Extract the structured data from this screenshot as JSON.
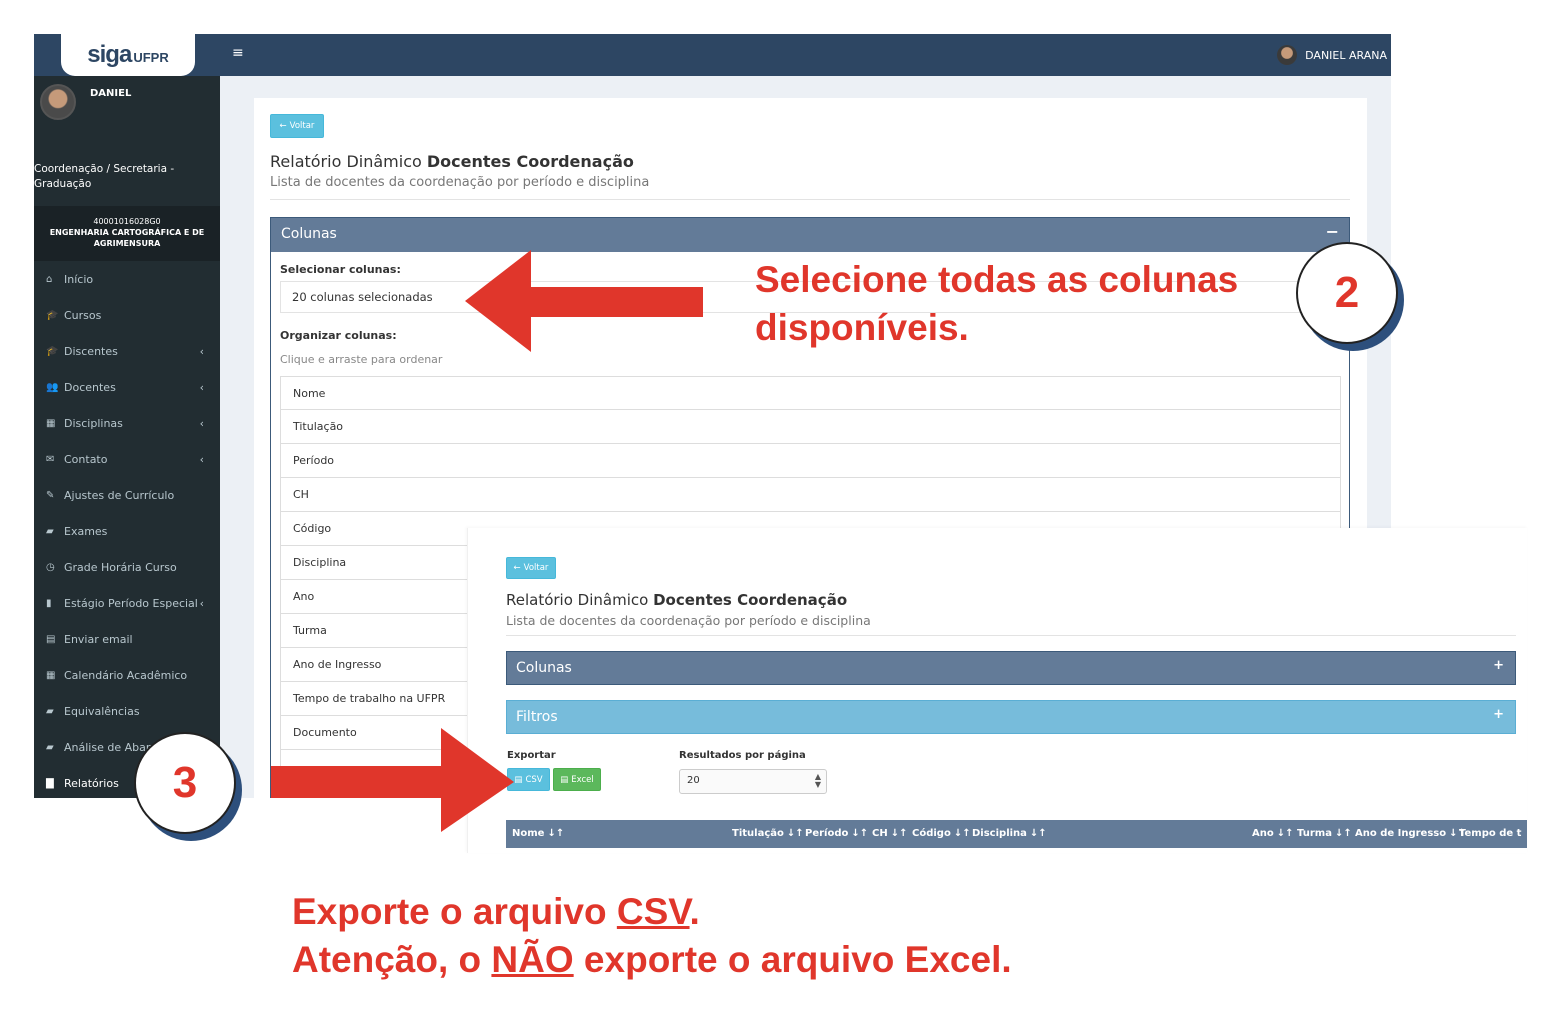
{
  "app": {
    "logo_main": "siga",
    "logo_sub": "UFPR",
    "top_user": "DANIEL ARANA"
  },
  "sidebar": {
    "user_name": "DANIEL",
    "role": "Coordenação / Secretaria - Graduação",
    "course_code": "40001016028G0",
    "course_name": "ENGENHARIA CARTOGRÁFICA E DE AGRIMENSURA",
    "items": [
      {
        "label": "Início",
        "icon": "home-icon",
        "glyph": "⌂",
        "chevron": ""
      },
      {
        "label": "Cursos",
        "icon": "graduation-cap-icon",
        "glyph": "🎓",
        "chevron": ""
      },
      {
        "label": "Discentes",
        "icon": "graduation-cap-icon",
        "glyph": "🎓",
        "chevron": "‹"
      },
      {
        "label": "Docentes",
        "icon": "users-icon",
        "glyph": "👥",
        "chevron": "‹"
      },
      {
        "label": "Disciplinas",
        "icon": "grid-icon",
        "glyph": "▦",
        "chevron": "‹"
      },
      {
        "label": "Contato",
        "icon": "envelope-icon",
        "glyph": "✉",
        "chevron": "‹"
      },
      {
        "label": "Ajustes de Currículo",
        "icon": "edit-icon",
        "glyph": "✎",
        "chevron": ""
      },
      {
        "label": "Exames",
        "icon": "book-icon",
        "glyph": "▰",
        "chevron": ""
      },
      {
        "label": "Grade Horária Curso",
        "icon": "clock-icon",
        "glyph": "◷",
        "chevron": ""
      },
      {
        "label": "Estágio Período Especial",
        "icon": "briefcase-icon",
        "glyph": "▮",
        "chevron": "‹"
      },
      {
        "label": "Enviar email",
        "icon": "file-icon",
        "glyph": "▤",
        "chevron": ""
      },
      {
        "label": "Calendário Acadêmico",
        "icon": "calendar-icon",
        "glyph": "▦",
        "chevron": ""
      },
      {
        "label": "Equivalências",
        "icon": "book-icon",
        "glyph": "▰",
        "chevron": ""
      },
      {
        "label": "Análise de Aban",
        "icon": "book-icon",
        "glyph": "▰",
        "chevron": ""
      },
      {
        "label": "Relatórios",
        "icon": "document-icon",
        "glyph": "▇",
        "chevron": ""
      }
    ]
  },
  "page": {
    "back_label": "Voltar",
    "title_prefix": "Relatório Dinâmico",
    "title_bold": "Docentes Coordenação",
    "subtitle": "Lista de docentes da coordenação por período e disciplina",
    "colunas_title": "Colunas",
    "colunas_toggle": "−",
    "select_label": "Selecionar colunas:",
    "select_value": "20 colunas selecionadas",
    "organize_label": "Organizar colunas:",
    "drag_hint": "Clique e arraste para ordenar",
    "columns": [
      "Nome",
      "Titulação",
      "Período",
      "CH",
      "Código",
      "Disciplina",
      "Ano",
      "Turma",
      "Ano de Ingresso",
      "Tempo de trabalho na UFPR",
      "Documento",
      ""
    ]
  },
  "front": {
    "back_label": "Voltar",
    "title_prefix": "Relatório Dinâmico",
    "title_bold": "Docentes Coordenação",
    "subtitle": "Lista de docentes da coordenação por período e disciplina",
    "colunas_title": "Colunas",
    "filtros_title": "Filtros",
    "toggle": "+",
    "export_label": "Exportar",
    "csv_label": "CSV",
    "excel_label": "Excel",
    "per_page_label": "Resultados por página",
    "per_page_value": "20",
    "table_headers": [
      "Nome",
      "Titulação",
      "Período",
      "CH",
      "Código",
      "Disciplina",
      "Ano",
      "Turma",
      "Ano de Ingresso",
      "Tempo de t"
    ],
    "sort_glyph": "↓↑"
  },
  "annotations": {
    "step2_text_line1": "Selecione todas as colunas",
    "step2_text_line2": "disponíveis.",
    "step2_number": "2",
    "step3_number": "3",
    "bottom_line1_prefix": "Exporte o arquivo ",
    "bottom_line1_underlined": "CSV",
    "bottom_line1_suffix": ".",
    "bottom_line2_prefix": "Atenção, o ",
    "bottom_line2_underlined": "NÃO",
    "bottom_line2_suffix": " exporte o arquivo Excel.",
    "color_red": "#e0362b",
    "color_navy": "#2d4663"
  }
}
